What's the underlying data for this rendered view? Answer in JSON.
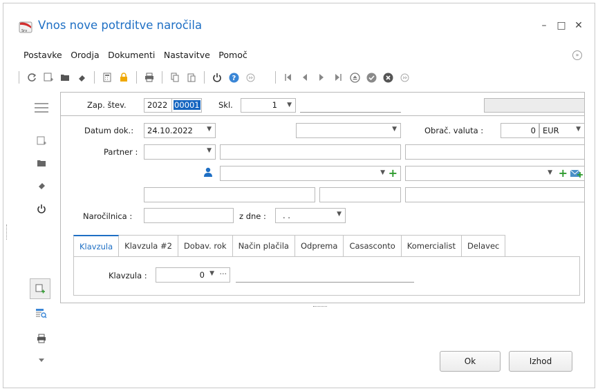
{
  "window": {
    "title": "Vnos nove potrditve naročila",
    "minimize": "–",
    "maximize": "□",
    "close": "✕"
  },
  "menu": {
    "items": [
      "Postavke",
      "Orodja",
      "Dokumenti",
      "Nastavitve",
      "Pomoč"
    ]
  },
  "form": {
    "zap_stev_label": "Zap. štev.",
    "zap_year": "2022",
    "zap_number": "00001",
    "skl_label": "Skl.",
    "skl_value": "1",
    "datum_label": "Datum dok.:",
    "datum_value": "24.10.2022",
    "obrac_label": "Obrač. valuta :",
    "obrac_value": "0",
    "currency": "EUR",
    "partner_label": "Partner :",
    "narocilnica_label": "Naročilnica :",
    "zdne_label": "z dne :",
    "zdne_value": ". ."
  },
  "tabs": [
    "Klavzula",
    "Klavzula #2",
    "Dobav. rok",
    "Način plačila",
    "Odprema",
    "Casasconto",
    "Komercialist",
    "Delavec"
  ],
  "tab_content": {
    "klavzula_label": "Klavzula :",
    "klavzula_value": "0",
    "ellipsis": "···"
  },
  "buttons": {
    "ok": "Ok",
    "izhod": "Izhod"
  },
  "colors": {
    "accent": "#1e6fc4",
    "green": "#2e9b2e"
  }
}
